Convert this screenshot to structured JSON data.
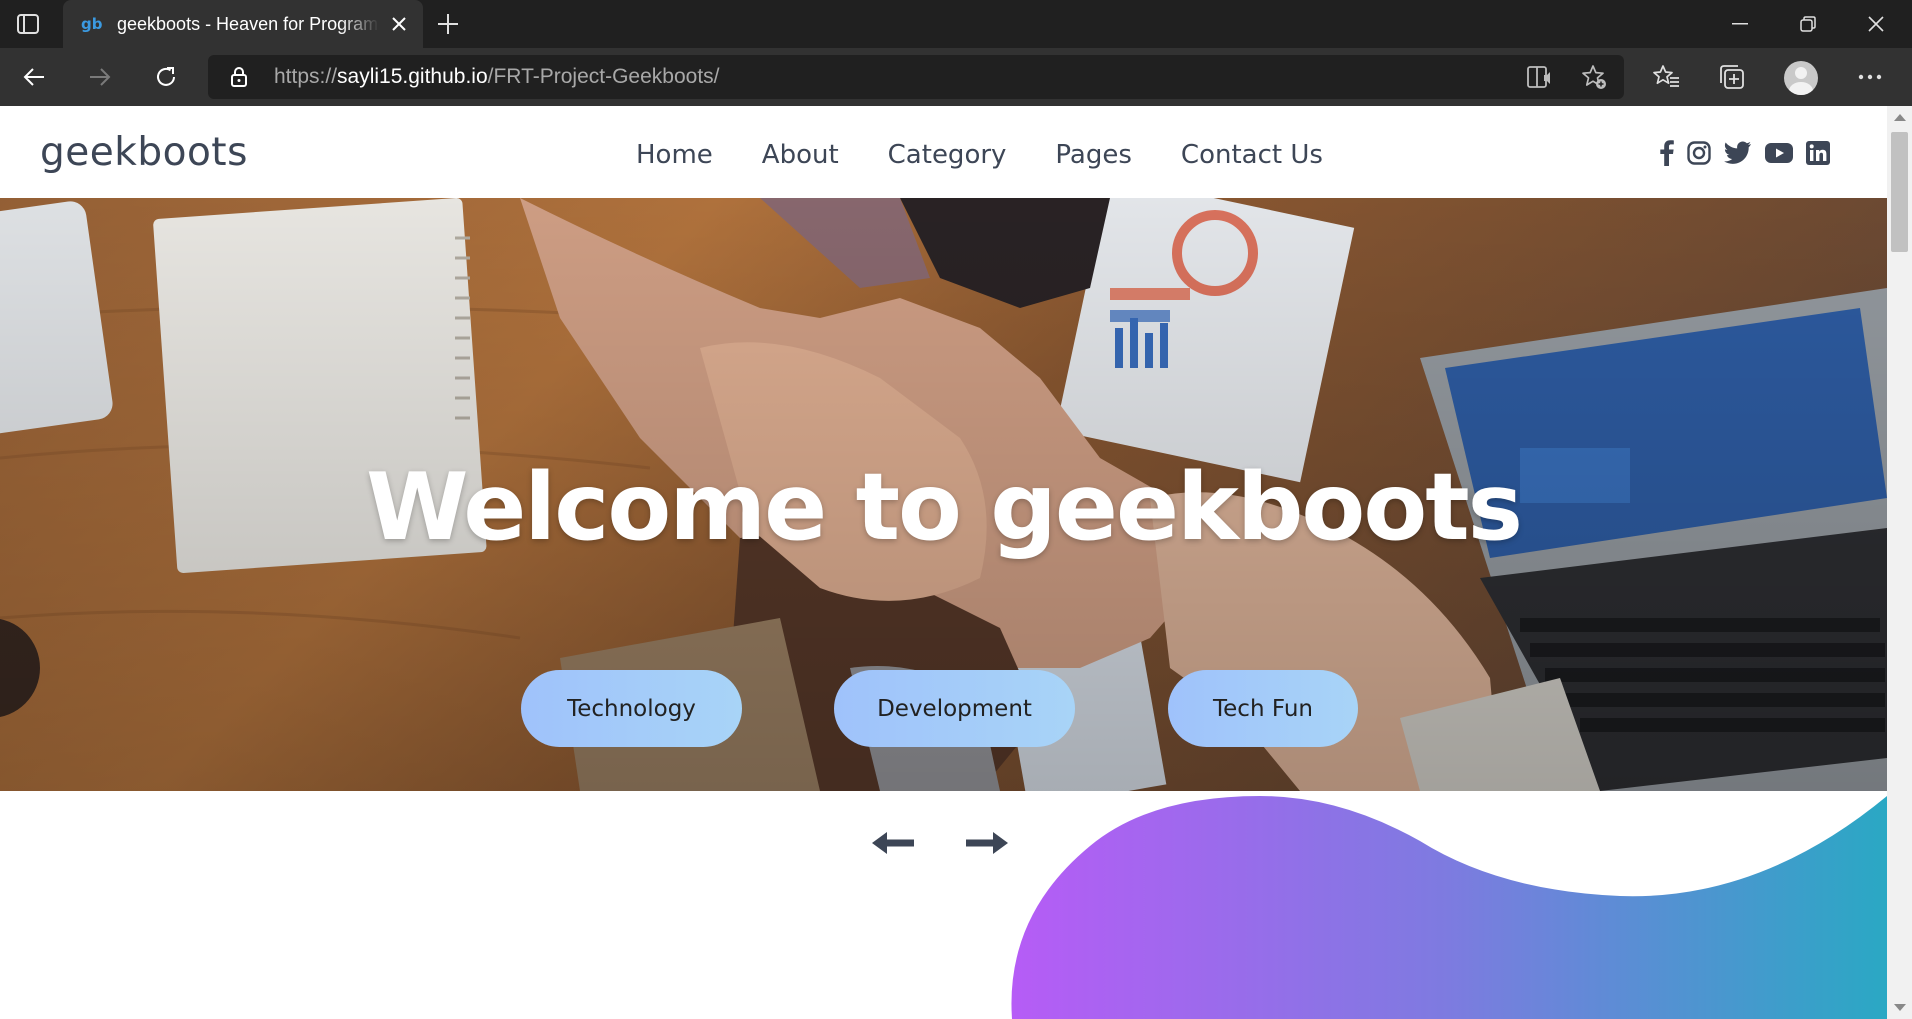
{
  "browser": {
    "tab": {
      "favicon": "gb",
      "title": "geekboots - Heaven for Programmers"
    },
    "address": {
      "scheme": "https://",
      "host": "sayli15.github.io",
      "path": "/FRT-Project-Geekboots/"
    },
    "icons": [
      "tab-actions-icon",
      "close-icon",
      "plus-icon",
      "minimize-icon",
      "restore-icon",
      "back-icon",
      "forward-icon",
      "refresh-icon",
      "lock-icon",
      "read-aloud-icon",
      "add-favorite-icon",
      "favorites-icon",
      "collections-icon",
      "profile-avatar",
      "more-icon"
    ]
  },
  "site": {
    "logo": "geekboots",
    "nav": [
      "Home",
      "About",
      "Category",
      "Pages",
      "Contact Us"
    ],
    "social": [
      "facebook-icon",
      "instagram-icon",
      "twitter-icon",
      "youtube-icon",
      "linkedin-icon"
    ],
    "hero": {
      "title": "Welcome to geekboots",
      "buttons": [
        "Technology",
        "Development",
        "Tech Fun"
      ]
    },
    "colors": {
      "text_dark": "#3d4656",
      "pill_gradient": [
        "#9fc2fb",
        "#a8d4f7"
      ],
      "blob_gradient": [
        "#b75cf5",
        "#2aa7c6"
      ]
    }
  }
}
